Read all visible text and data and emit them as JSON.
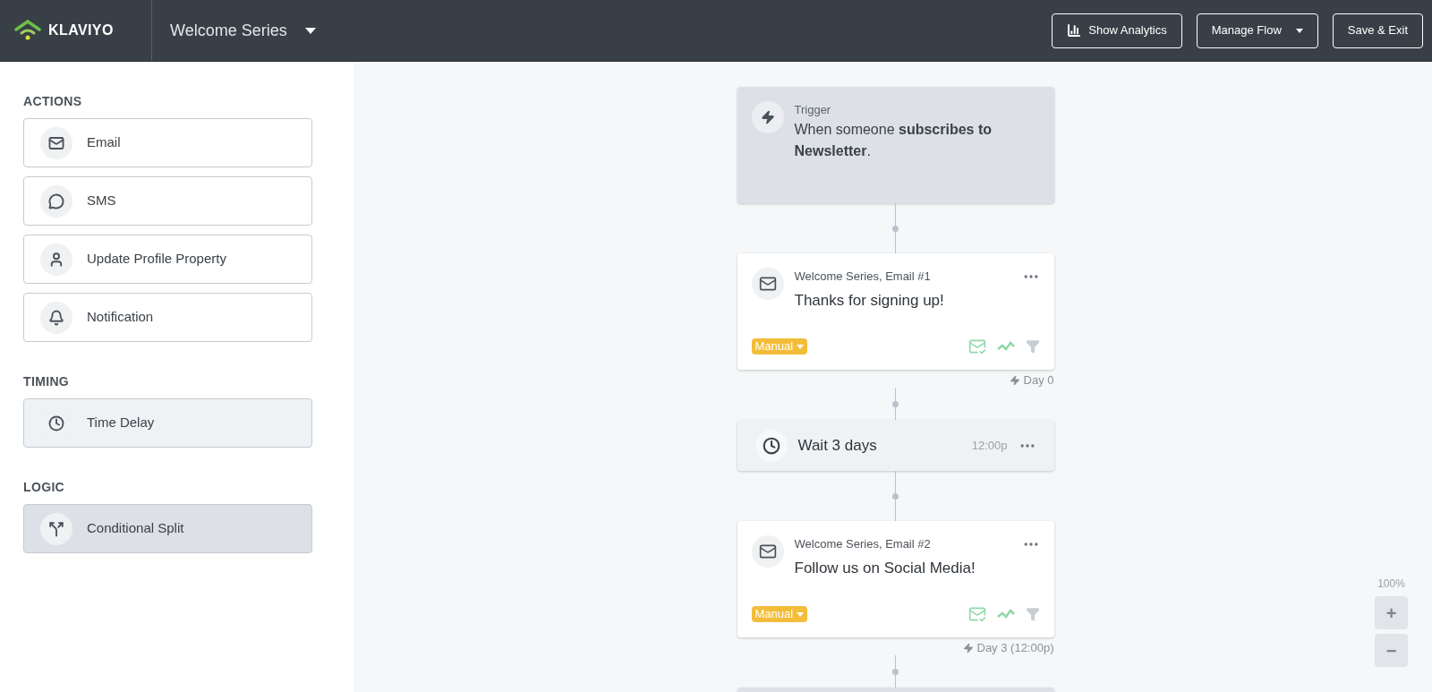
{
  "header": {
    "logo": "KLAVIYO",
    "flow_name": "Welcome Series",
    "buttons": [
      {
        "kind": "analytics",
        "label": "Show Analytics"
      },
      {
        "kind": "dropdown",
        "label": "Manage Flow"
      },
      {
        "kind": "plain",
        "label": "Save & Exit"
      }
    ]
  },
  "sidebar": {
    "groups": [
      {
        "title": "ACTIONS",
        "kind": "action",
        "items": [
          {
            "kind": "email",
            "label": "Email"
          },
          {
            "kind": "sms",
            "label": "SMS"
          },
          {
            "kind": "profile",
            "label": "Update Profile Property"
          },
          {
            "kind": "notification",
            "label": "Notification"
          }
        ]
      },
      {
        "title": "TIMING",
        "kind": "timing",
        "items": [
          {
            "kind": "delay",
            "label": "Time Delay"
          }
        ]
      },
      {
        "title": "LOGIC",
        "kind": "logic",
        "items": [
          {
            "kind": "split",
            "label": "Conditional Split"
          }
        ]
      }
    ]
  },
  "flow": [
    {
      "kind": "trigger",
      "label": "Trigger",
      "text": "When someone **subscribes to Newsletter**."
    },
    {
      "kind": "email",
      "title": "Welcome Series, Email #1",
      "subject": "Thanks for signing up!",
      "status": "Manual",
      "timing": "Day 0"
    },
    {
      "kind": "delay",
      "text": "Wait 3 days",
      "time": "12:00p"
    },
    {
      "kind": "email",
      "title": "Welcome Series, Email #2",
      "subject": "Follow us on Social Media!",
      "status": "Manual",
      "timing": "Day 3 (12:00p)"
    }
  ],
  "zoom": {
    "level": "100%",
    "in": "+",
    "out": "−"
  }
}
